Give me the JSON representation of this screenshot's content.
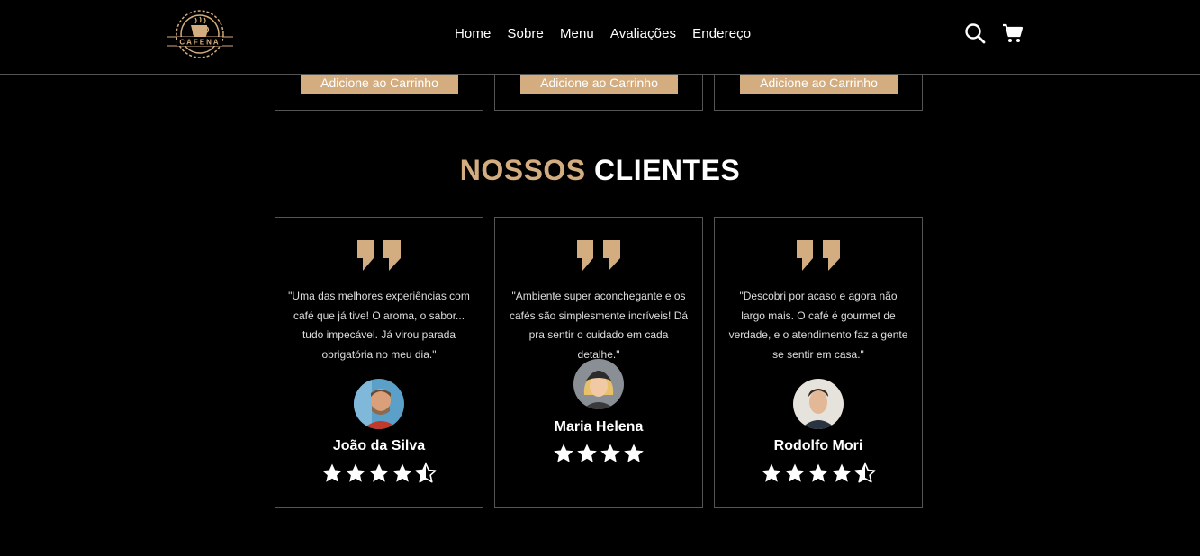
{
  "header": {
    "logo_text": "CAFENA",
    "nav": [
      "Home",
      "Sobre",
      "Menu",
      "Avaliações",
      "Endereço"
    ],
    "icons": [
      "search-icon",
      "cart-icon"
    ]
  },
  "products": {
    "button_label": "Adicione ao Carrinho",
    "cards": [
      {
        "button": "Adicione ao Carrinho"
      },
      {
        "button": "Adicione ao Carrinho"
      },
      {
        "button": "Adicione ao Carrinho"
      }
    ]
  },
  "reviews_section": {
    "title_accent": "NOSSOS",
    "title_main": "CLIENTES",
    "reviews": [
      {
        "text": "\"Uma das melhores experiências com café que já tive! O aroma, o sabor... tudo impecável. Já virou parada obrigatória no meu dia.\"",
        "name": "João da Silva",
        "rating": 4.5
      },
      {
        "text": "\"Ambiente super aconchegante e os cafés são simplesmente incríveis! Dá pra sentir o cuidado em cada detalhe.\"",
        "name": "Maria Helena",
        "rating": 4
      },
      {
        "text": "\"Descobri por acaso e agora não largo mais. O café é gourmet de verdade, e o atendimento faz a gente se sentir em casa.\"",
        "name": "Rodolfo Mori",
        "rating": 4.5
      }
    ]
  },
  "colors": {
    "accent": "#d3ad7f",
    "background": "#000000",
    "border": "#555555"
  }
}
